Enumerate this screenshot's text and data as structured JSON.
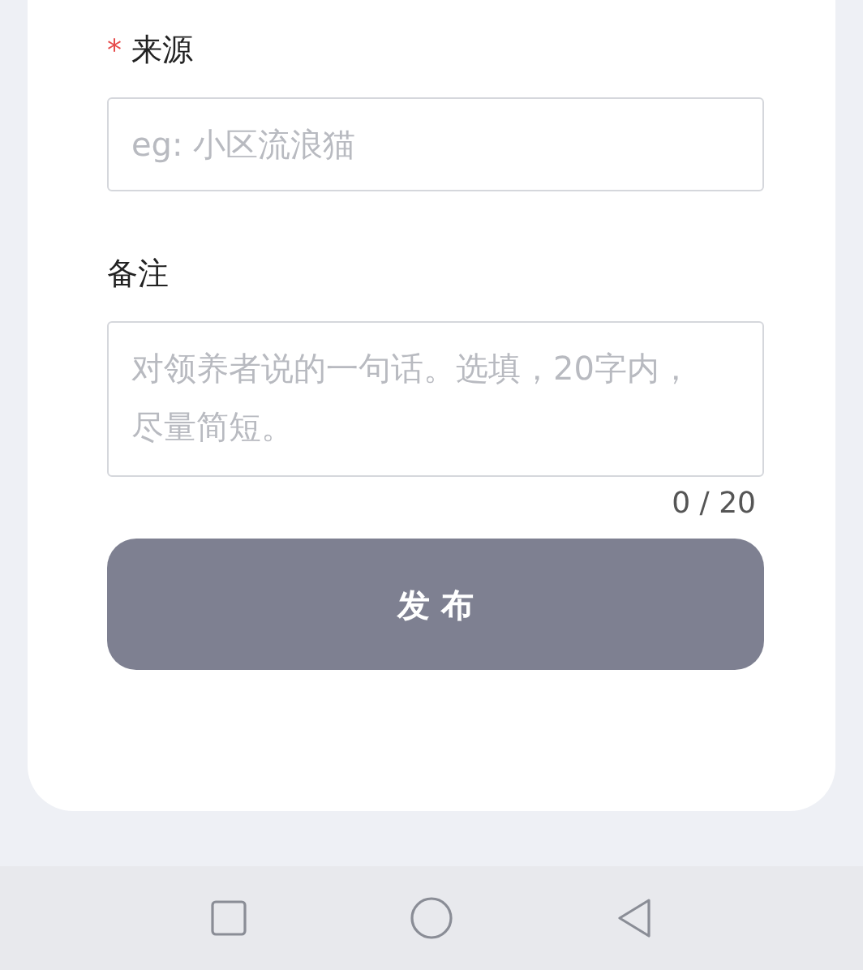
{
  "form": {
    "fields": [
      {
        "kind": "input",
        "label": "来源",
        "required_mark": "*",
        "placeholder": "eg: 小区流浪猫"
      },
      {
        "kind": "textarea",
        "label": "备注",
        "placeholder": "对领养者说的一句话。选填，20字内，尽量简短。",
        "counter": "0 / 20"
      }
    ],
    "submit": "发 布"
  }
}
